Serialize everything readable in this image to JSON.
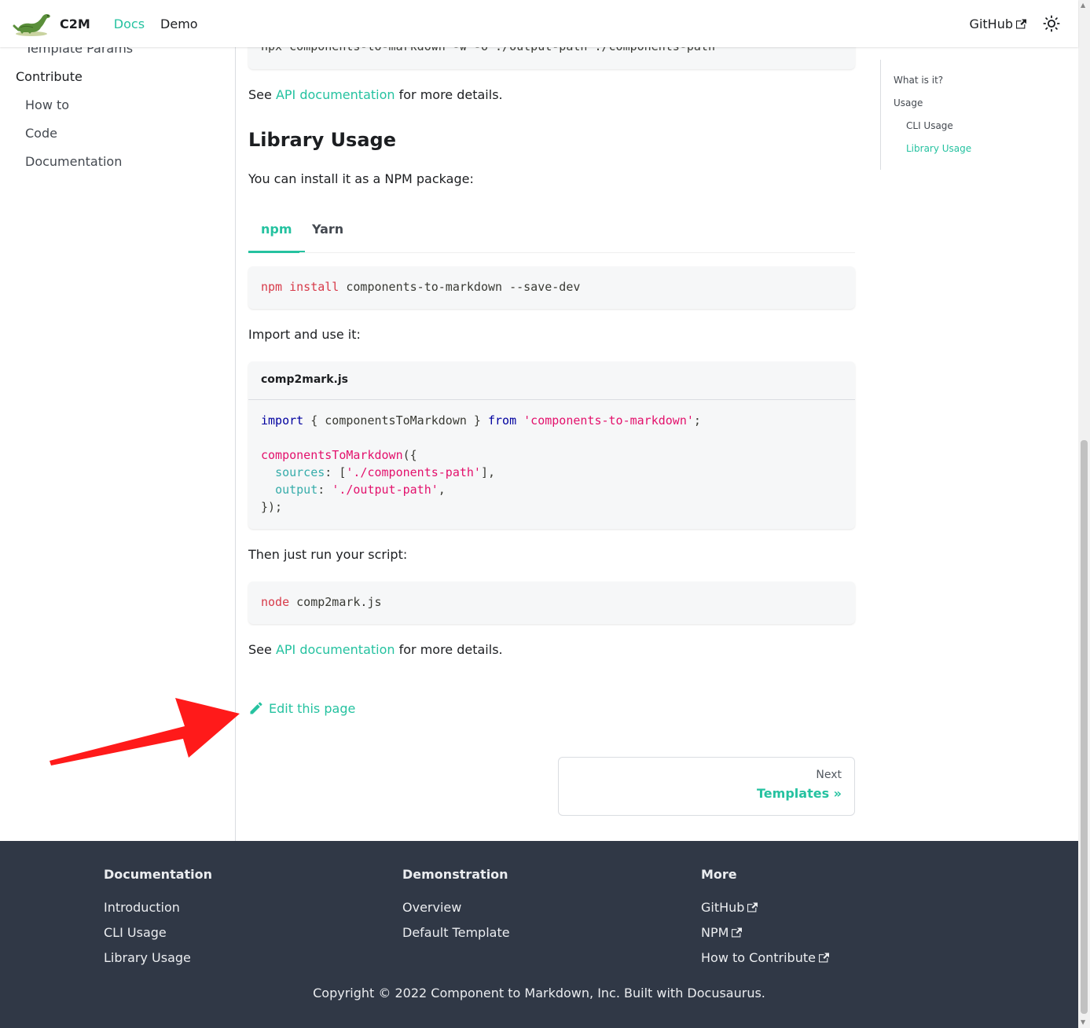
{
  "navbar": {
    "brand": "C2M",
    "links": [
      "Docs",
      "Demo"
    ],
    "github": "GitHub"
  },
  "sidebar": {
    "partial_item": "Template Params",
    "section": "Contribute",
    "items": [
      "How to",
      "Code",
      "Documentation"
    ]
  },
  "main": {
    "cli_command": "npx components-to-markdown -w -o ./output-path ./components-path",
    "see_prefix": "See ",
    "api_link": "API documentation",
    "see_suffix": " for more details.",
    "heading": "Library Usage",
    "install_intro": "You can install it as a NPM package:",
    "tabs": [
      "npm",
      "Yarn"
    ],
    "install_cmd": {
      "cmd": "npm",
      "sub": "install",
      "rest": " components-to-markdown --save-dev"
    },
    "import_intro": "Import and use it:",
    "code_title": "comp2mark.js",
    "code": {
      "l1_kw": "import",
      "l1_mid": " { componentsToMarkdown } ",
      "l1_from": "from",
      "l1_str": "'components-to-markdown'",
      "l1_end": ";",
      "l3_fn": "componentsToMarkdown",
      "l3_end": "({",
      "l4_prop": "sources",
      "l4_mid": ": [",
      "l4_str": "'./components-path'",
      "l4_end": "],",
      "l5_prop": "output",
      "l5_mid": ": ",
      "l5_str": "'./output-path'",
      "l5_end": ",",
      "l6": "});"
    },
    "run_intro": "Then just run your script:",
    "run_cmd": {
      "cmd": "node",
      "rest": " comp2mark.js"
    },
    "edit_link": "Edit this page"
  },
  "toc": {
    "items": [
      "What is it?",
      "Usage",
      "CLI Usage",
      "Library Usage"
    ]
  },
  "pagination": {
    "sub": "Next",
    "label": "Templates »"
  },
  "footer": {
    "columns": [
      {
        "title": "Documentation",
        "links": [
          "Introduction",
          "CLI Usage",
          "Library Usage"
        ]
      },
      {
        "title": "Demonstration",
        "links": [
          "Overview",
          "Default Template"
        ]
      },
      {
        "title": "More",
        "links": [
          "GitHub",
          "NPM",
          "How to Contribute"
        ]
      }
    ],
    "copyright": "Copyright © 2022 Component to Markdown, Inc. Built with Docusaurus."
  },
  "colors": {
    "primary": "#25c2a0",
    "footer_bg": "#303846",
    "annotation_arrow": "#ff0000"
  }
}
